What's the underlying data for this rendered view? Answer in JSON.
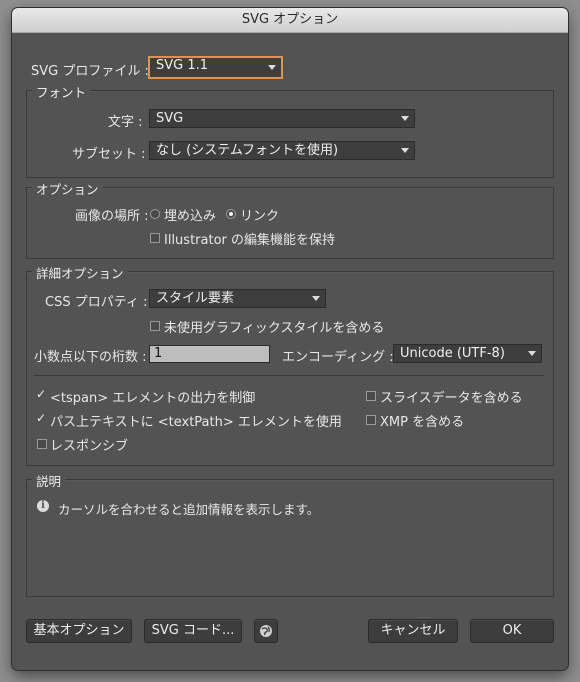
{
  "window": {
    "title": "SVG オプション"
  },
  "profile": {
    "label": "SVG プロファイル :",
    "value": "SVG 1.1"
  },
  "font_section": {
    "title": "フォント",
    "char_label": "文字 :",
    "char_value": "SVG",
    "subset_label": "サブセット :",
    "subset_value": "なし (システムフォントを使用)"
  },
  "options_section": {
    "title": "オプション",
    "image_location_label": "画像の場所 :",
    "embed_label": "埋め込み",
    "link_label": "リンク",
    "selected": "link",
    "preserve_editing_label": "Illustrator の編集機能を保持",
    "preserve_editing_checked": false
  },
  "advanced_section": {
    "title": "詳細オプション",
    "css_label": "CSS プロパティ :",
    "css_value": "スタイル要素",
    "unused_styles_label": "未使用グラフィックスタイルを含める",
    "unused_styles_checked": false,
    "decimal_label": "小数点以下の桁数 :",
    "decimal_value": "1",
    "encoding_label": "エンコーディング :",
    "encoding_value": "Unicode (UTF-8)",
    "tspan_label": "<tspan> エレメントの出力を制御",
    "tspan_checked": true,
    "textpath_label": "パス上テキストに <textPath> エレメントを使用",
    "textpath_checked": true,
    "responsive_label": "レスポンシブ",
    "responsive_checked": false,
    "slice_label": "スライスデータを含める",
    "slice_checked": false,
    "xmp_label": "XMP を含める",
    "xmp_checked": false
  },
  "description_section": {
    "title": "説明",
    "text": "カーソルを合わせると追加情報を表示します。",
    "icon": "info-icon"
  },
  "footer": {
    "basic_options": "基本オプション",
    "svg_code": "SVG コード...",
    "web_icon": "globe-icon",
    "cancel": "キャンセル",
    "ok": "OK"
  },
  "colors": {
    "dialog_bg": "#535353",
    "focus_ring": "#e0944a",
    "control_bg": "#3e3e3e"
  }
}
